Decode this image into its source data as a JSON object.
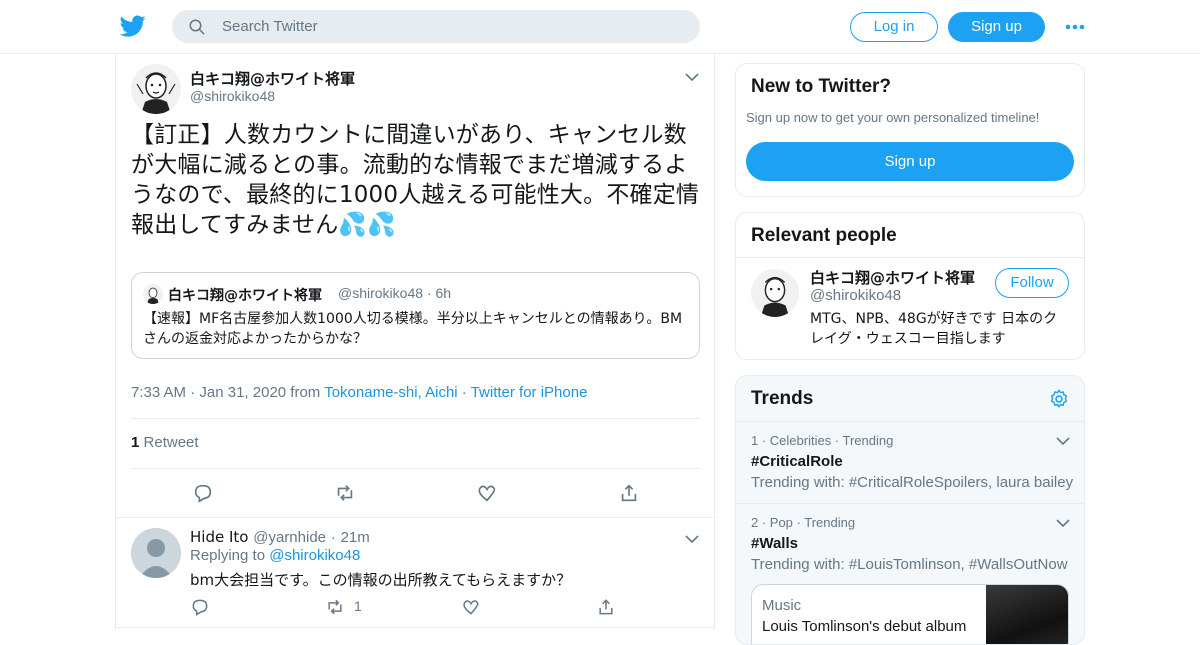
{
  "header": {
    "search_placeholder": "Search Twitter",
    "login_label": "Log in",
    "signup_label": "Sign up"
  },
  "tweet": {
    "name": "白キコ翔@ホワイト将軍",
    "handle": "@shirokiko48",
    "text": "【訂正】人数カウントに間違いがあり、キャンセル数が大幅に減るとの事。流動的な情報でまだ増減するようなので、最終的に1000人越える可能性大。不確定情報出してすみません💦💦",
    "quote": {
      "name": "白キコ翔@ホワイト将軍",
      "handle_time": "@shirokiko48 · 6h",
      "text": "【速報】MF名古屋参加人数1000人切る模様。半分以上キャンセルとの情報あり。BMさんの返金対応よかったからかな？"
    },
    "time": "7:33 AM",
    "date": "Jan 31, 2020 from",
    "location": "Tokoname-shi, Aichi",
    "client": "Twitter for iPhone",
    "retweet_count": "1",
    "retweet_label": "Retweet"
  },
  "reply": {
    "name": "Hide Ito",
    "handle": "@yarnhide",
    "time": "21m",
    "replying_label": "Replying to",
    "replying_handle": "@shirokiko48",
    "text": "bm大会担当です。この情報の出所教えてもらえますか？",
    "retweet_count": "1"
  },
  "sidebar": {
    "new": {
      "title": "New to Twitter?",
      "subtitle": "Sign up now to get your own personalized timeline!",
      "button": "Sign up"
    },
    "relevant": {
      "title": "Relevant people",
      "name": "白キコ翔@ホワイト将軍",
      "handle": "@shirokiko48",
      "follow": "Follow",
      "bio": "MTG、NPB、48Gが好きです 日本のクレイグ・ウェスコー目指します"
    },
    "trends": {
      "title": "Trends",
      "items": [
        {
          "meta": "1 · Celebrities · Trending",
          "name": "#CriticalRole",
          "with": "Trending with: #CriticalRoleSpoilers, laura bailey"
        },
        {
          "meta": "2 · Pop · Trending",
          "name": "#Walls",
          "with": "Trending with: #LouisTomlinson, #WallsOutNow"
        }
      ],
      "news": {
        "category": "Music",
        "headline": "Louis Tomlinson's debut album"
      }
    }
  },
  "colors": {
    "accent": "#1da1f2",
    "link": "#1b95e0",
    "border": "#e6ecf0",
    "secondary_text": "#657786"
  }
}
